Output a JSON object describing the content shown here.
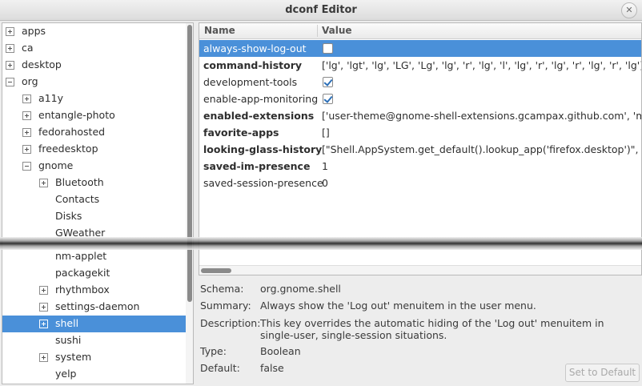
{
  "window": {
    "title": "dconf Editor"
  },
  "tree": [
    {
      "label": "apps",
      "depth": 0,
      "expander": "plus",
      "selected": false
    },
    {
      "label": "ca",
      "depth": 0,
      "expander": "plus",
      "selected": false
    },
    {
      "label": "desktop",
      "depth": 0,
      "expander": "plus",
      "selected": false
    },
    {
      "label": "org",
      "depth": 0,
      "expander": "minus",
      "selected": false
    },
    {
      "label": "a11y",
      "depth": 1,
      "expander": "plus",
      "selected": false
    },
    {
      "label": "entangle-photo",
      "depth": 1,
      "expander": "plus",
      "selected": false
    },
    {
      "label": "fedorahosted",
      "depth": 1,
      "expander": "plus",
      "selected": false
    },
    {
      "label": "freedesktop",
      "depth": 1,
      "expander": "plus",
      "selected": false
    },
    {
      "label": "gnome",
      "depth": 1,
      "expander": "minus",
      "selected": false
    },
    {
      "label": "Bluetooth",
      "depth": 2,
      "expander": "plus",
      "selected": false
    },
    {
      "label": "Contacts",
      "depth": 2,
      "expander": "none",
      "selected": false
    },
    {
      "label": "Disks",
      "depth": 2,
      "expander": "none",
      "selected": false
    },
    {
      "label": "GWeather",
      "depth": 2,
      "expander": "none",
      "selected": false
    },
    {
      "label": "nm-applet",
      "depth": 2,
      "expander": "none",
      "selected": false
    },
    {
      "label": "packagekit",
      "depth": 2,
      "expander": "none",
      "selected": false
    },
    {
      "label": "rhythmbox",
      "depth": 2,
      "expander": "plus",
      "selected": false
    },
    {
      "label": "settings-daemon",
      "depth": 2,
      "expander": "plus",
      "selected": false
    },
    {
      "label": "shell",
      "depth": 2,
      "expander": "plus",
      "selected": true
    },
    {
      "label": "sushi",
      "depth": 2,
      "expander": "none",
      "selected": false
    },
    {
      "label": "system",
      "depth": 2,
      "expander": "plus",
      "selected": false
    },
    {
      "label": "yelp",
      "depth": 2,
      "expander": "none",
      "selected": false
    }
  ],
  "table": {
    "headers": {
      "name": "Name",
      "value": "Value"
    },
    "rows": [
      {
        "name": "always-show-log-out",
        "bold": false,
        "type": "checkbox",
        "checked": false,
        "value": "",
        "selected": true
      },
      {
        "name": "command-history",
        "bold": true,
        "type": "text",
        "checked": false,
        "value": "['lg', 'lgt', 'lg', 'LG', 'Lg', 'lg', 'r', 'lg', 'l', 'lg', 'r', 'lg', 'r', 'lg', 'r', 'lg']",
        "selected": false
      },
      {
        "name": "development-tools",
        "bold": false,
        "type": "checkbox",
        "checked": true,
        "value": "",
        "selected": false
      },
      {
        "name": "enable-app-monitoring",
        "bold": false,
        "type": "checkbox",
        "checked": true,
        "value": "",
        "selected": false
      },
      {
        "name": "enabled-extensions",
        "bold": true,
        "type": "text",
        "checked": false,
        "value": "['user-theme@gnome-shell-extensions.gcampax.github.com', 'mylau",
        "selected": false
      },
      {
        "name": "favorite-apps",
        "bold": true,
        "type": "text",
        "checked": false,
        "value": "[]",
        "selected": false
      },
      {
        "name": "looking-glass-history",
        "bold": true,
        "type": "text",
        "checked": false,
        "value": "[\"Shell.AppSystem.get_default().lookup_app('firefox.desktop')\", 'Shell.",
        "selected": false
      },
      {
        "name": "saved-im-presence",
        "bold": true,
        "type": "text",
        "checked": false,
        "value": "1",
        "selected": false
      },
      {
        "name": "saved-session-presence",
        "bold": false,
        "type": "text",
        "checked": false,
        "value": "0",
        "selected": false
      }
    ]
  },
  "details": {
    "schema_label": "Schema:",
    "schema": "org.gnome.shell",
    "summary_label": "Summary:",
    "summary": "Always show the 'Log out' menuitem in the user menu.",
    "description_label": "Description:",
    "description": "This key overrides the automatic hiding of the 'Log out' menuitem in single-user, single-session situations.",
    "type_label": "Type:",
    "type": "Boolean",
    "default_label": "Default:",
    "default": "false"
  },
  "buttons": {
    "set_default": "Set to Default"
  },
  "colors": {
    "selection": "#4a90d9"
  }
}
